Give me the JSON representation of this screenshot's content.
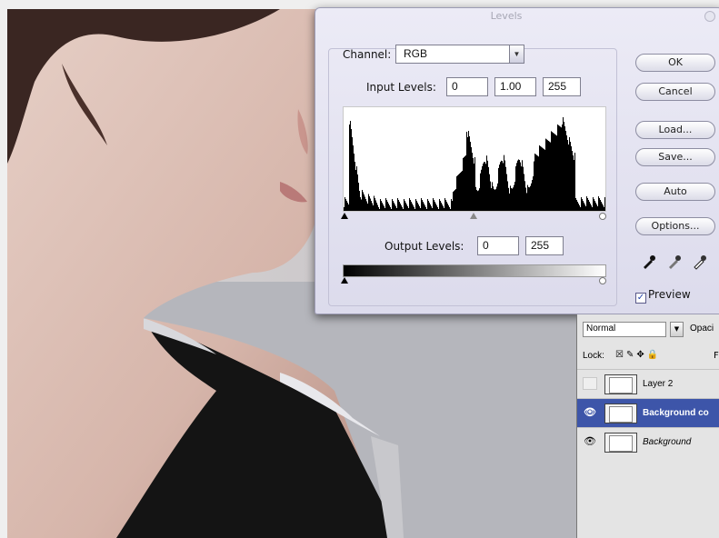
{
  "dialog": {
    "title": "Levels",
    "channel_label": "Channel:",
    "channel_value": "RGB",
    "input_levels_label": "Input Levels:",
    "input_levels": {
      "black": "0",
      "gamma": "1.00",
      "white": "255"
    },
    "output_levels_label": "Output Levels:",
    "output_levels": {
      "black": "0",
      "white": "255"
    },
    "buttons": {
      "ok": "OK",
      "cancel": "Cancel",
      "load": "Load...",
      "save": "Save...",
      "auto": "Auto",
      "options": "Options..."
    },
    "preview_label": "Preview",
    "preview_checked": true,
    "dropper_icons": [
      "black-eyedropper-icon",
      "gray-eyedropper-icon",
      "white-eyedropper-icon"
    ]
  },
  "layers_panel": {
    "blend_mode": "Normal",
    "opacity_label": "Opaci",
    "lock_label": "Lock:",
    "layers": [
      {
        "name": "Layer 2",
        "visible": false,
        "selected": false
      },
      {
        "name": "Background co",
        "visible": true,
        "selected": true
      },
      {
        "name": "Background",
        "visible": true,
        "selected": false,
        "italic": true
      }
    ]
  },
  "colors": {
    "dialog_bg": "#e6e5f2",
    "selection": "#3d55a9",
    "histogram": "#000000"
  }
}
